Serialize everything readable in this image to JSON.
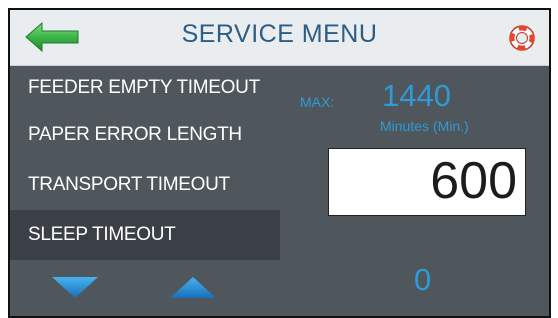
{
  "header": {
    "title": "SERVICE MENU",
    "back_icon": "left-arrow-icon",
    "help_icon": "life-ring-icon"
  },
  "menu": {
    "items": [
      {
        "label": "FEEDER EMPTY TIMEOUT",
        "selected": false
      },
      {
        "label": "PAPER ERROR LENGTH",
        "selected": false
      },
      {
        "label": "TRANSPORT TIMEOUT",
        "selected": false
      },
      {
        "label": "SLEEP TIMEOUT",
        "selected": true
      }
    ]
  },
  "setting": {
    "max_label": "MAX:",
    "max_value": "1440",
    "units": "Minutes (Min.)",
    "current_value": "600"
  },
  "footer": {
    "down_icon": "triangle-down-icon",
    "up_icon": "triangle-up-icon",
    "counter": "0"
  },
  "colors": {
    "accent": "#2f9bd6",
    "panel": "#4f565c",
    "header": "#e9edf0",
    "arrow_green": "#39b54a",
    "help_red": "#e8442e"
  }
}
